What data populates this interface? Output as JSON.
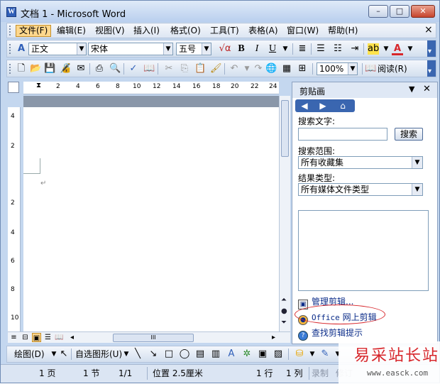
{
  "window": {
    "title": "文档 1 - Microsoft Word",
    "app_icon": "W",
    "caption": {
      "minimize": "–",
      "maximize": "□",
      "close": "✕"
    }
  },
  "menubar": {
    "items": [
      "文件(F)",
      "编辑(E)",
      "视图(V)",
      "插入(I)",
      "格式(O)",
      "工具(T)",
      "表格(A)",
      "窗口(W)",
      "帮助(H)"
    ],
    "active": "文件(F)",
    "close": "×"
  },
  "formatting": {
    "style": "正文",
    "font": "宋体",
    "size": "五号",
    "bold": "B",
    "italic": "I",
    "underline": "U",
    "font_color_label": "A"
  },
  "standard": {
    "zoom": "100%",
    "read_mode": "阅读(R)"
  },
  "ruler": {
    "top_ticks": [
      "2",
      "4",
      "6",
      "8",
      "10",
      "12",
      "14",
      "16",
      "18",
      "20",
      "22",
      "24"
    ],
    "left_ticks": [
      "4",
      "2",
      "2",
      "4",
      "6",
      "8",
      "10"
    ]
  },
  "document": {
    "para_mark": "↵"
  },
  "hscroll": {
    "thumb": "III"
  },
  "task_pane": {
    "title": "剪贴画",
    "search_text_label": "搜索文字:",
    "search_input": "",
    "search_button": "搜索",
    "scope_label": "搜索范围:",
    "scope_value": "所有收藏集",
    "result_type_label": "结果类型:",
    "result_type_value": "所有媒体文件类型",
    "links": {
      "manage": "管理剪辑...",
      "office_online_prefix": "Office",
      "office_online_suffix": "网上剪辑",
      "tips": "查找剪辑提示"
    }
  },
  "drawing": {
    "draw_label": "绘图(D)",
    "autoshapes_label": "自选图形(U)"
  },
  "statusbar": {
    "page": "1 页",
    "section": "1 节",
    "pages": "1/1",
    "position": "位置 2.5厘米",
    "line": "1 行",
    "column": "1 列",
    "record": "录制",
    "revise": "修订"
  },
  "watermark": {
    "text": "易采站长站",
    "url": "www.easck.com"
  },
  "colors": {
    "accent": "#3a66b0",
    "highlight": "#ffd78c",
    "annotation_oval": "#d7262b"
  }
}
